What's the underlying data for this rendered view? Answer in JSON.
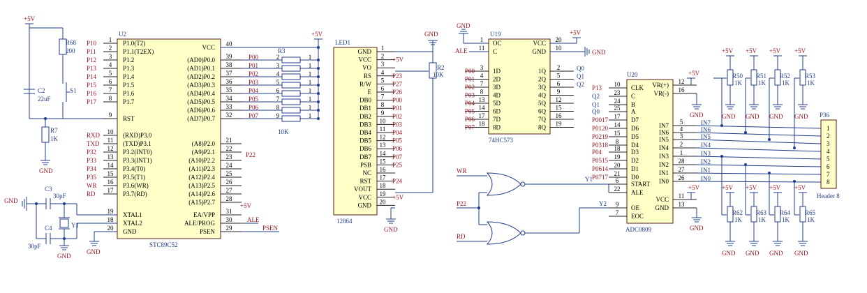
{
  "u2": {
    "ref": "U2",
    "name": "STC89C52",
    "left_pins": [
      {
        "num": "1",
        "name": "P1.0(T2)",
        "net": "P10"
      },
      {
        "num": "2",
        "name": "P1.1(T2EX)",
        "net": "P11"
      },
      {
        "num": "3",
        "name": "P1.2",
        "net": "P12"
      },
      {
        "num": "4",
        "name": "P1.3",
        "net": "P13"
      },
      {
        "num": "5",
        "name": "P1.4",
        "net": "P14"
      },
      {
        "num": "6",
        "name": "P1.5",
        "net": "P15"
      },
      {
        "num": "7",
        "name": "P1.6",
        "net": "P16"
      },
      {
        "num": "8",
        "name": "P1.7",
        "net": "P17"
      },
      {
        "num": "9",
        "name": "RST",
        "net": ""
      },
      {
        "num": "10",
        "name": "(RXD)P3.0",
        "net": "RXD"
      },
      {
        "num": "11",
        "name": "(TXD)P3.1",
        "net": "TXD"
      },
      {
        "num": "12",
        "name": "P3.2(INT0)",
        "net": "P32"
      },
      {
        "num": "13",
        "name": "P3.3(INT1)",
        "net": "P33"
      },
      {
        "num": "14",
        "name": "P3.4(T0)",
        "net": "P34"
      },
      {
        "num": "15",
        "name": "P3.5(T1)",
        "net": "P35"
      },
      {
        "num": "16",
        "name": "P3.6(WR)",
        "net": "WR"
      },
      {
        "num": "17",
        "name": "P3.7(RD)",
        "net": "RD"
      },
      {
        "num": "19",
        "name": "XTAL1",
        "net": ""
      },
      {
        "num": "18",
        "name": "XTAL2",
        "net": ""
      },
      {
        "num": "20",
        "name": "GND",
        "net": ""
      }
    ],
    "right_pins": [
      {
        "num": "40",
        "name": "VCC",
        "net": "+5V"
      },
      {
        "num": "39",
        "name": "(AD0)P0.0",
        "net": "P00"
      },
      {
        "num": "38",
        "name": "(AD1)P0.1",
        "net": "P01"
      },
      {
        "num": "37",
        "name": "(AD2)P0.2",
        "net": "P02"
      },
      {
        "num": "36",
        "name": "(AD3)P0.3",
        "net": "P03"
      },
      {
        "num": "35",
        "name": "(AD4)P0.4",
        "net": "P04"
      },
      {
        "num": "34",
        "name": "(AD5)P0.5",
        "net": "P05"
      },
      {
        "num": "33",
        "name": "(AD6)P0.6",
        "net": "P06"
      },
      {
        "num": "32",
        "name": "(AD7)P0.7",
        "net": "P07"
      },
      {
        "num": "21",
        "name": "(A8)P2.0",
        "net": ""
      },
      {
        "num": "22",
        "name": "(A9)P2.1",
        "net": "P22"
      },
      {
        "num": "23",
        "name": "(A10)P2.2",
        "net": ""
      },
      {
        "num": "24",
        "name": "(A11)P2.3",
        "net": ""
      },
      {
        "num": "25",
        "name": "(A12)P2.4",
        "net": ""
      },
      {
        "num": "26",
        "name": "(A13)P2.5",
        "net": ""
      },
      {
        "num": "27",
        "name": "(A14)P2.6",
        "net": ""
      },
      {
        "num": "28",
        "name": "(A15)P2.7",
        "net": ""
      },
      {
        "num": "31",
        "name": "EA/VPP",
        "net": "+5V"
      },
      {
        "num": "30",
        "name": "ALE/PROG",
        "net": "ALE"
      },
      {
        "num": "29",
        "name": "PSEN",
        "net": "PSEN"
      }
    ]
  },
  "r3": {
    "ref": "R3",
    "value": "10K",
    "pins": [
      "1",
      "2",
      "3",
      "4",
      "5",
      "6",
      "7",
      "8",
      "9"
    ]
  },
  "reset": {
    "vcc": "+5V",
    "r68_ref": "R68",
    "r68_val": "200",
    "c2_ref": "C2",
    "c2_val": "22uF",
    "s1_ref": "S1",
    "r7_ref": "R7",
    "r7_val": "1K",
    "gnd": "GND"
  },
  "xtal": {
    "c3_ref": "C3",
    "c3_val": "30pF",
    "c4_ref": "C4",
    "c4_val": "30pF",
    "y1_ref": "Y1",
    "gnd": "GND",
    "gnd2": "GND",
    "gnd3": "GND"
  },
  "led1": {
    "ref": "LED1",
    "name": "12864",
    "pins": [
      {
        "num": "1",
        "name": "GND",
        "net": ""
      },
      {
        "num": "2",
        "name": "VCC",
        "net": "+5V"
      },
      {
        "num": "3",
        "name": "VO",
        "net": ""
      },
      {
        "num": "4",
        "name": "RS",
        "net": "P23"
      },
      {
        "num": "5",
        "name": "R/W",
        "net": "P27"
      },
      {
        "num": "6",
        "name": "E",
        "net": "P26"
      },
      {
        "num": "7",
        "name": "DB0",
        "net": "P00"
      },
      {
        "num": "8",
        "name": "DB1",
        "net": "P01"
      },
      {
        "num": "9",
        "name": "DB2",
        "net": "P02"
      },
      {
        "num": "10",
        "name": "DB3",
        "net": "P03"
      },
      {
        "num": "11",
        "name": "DB4",
        "net": "P04"
      },
      {
        "num": "12",
        "name": "DB5",
        "net": "P05"
      },
      {
        "num": "13",
        "name": "DB6",
        "net": "P06"
      },
      {
        "num": "14",
        "name": "DB7",
        "net": "P07"
      },
      {
        "num": "15",
        "name": "PSB",
        "net": "P25"
      },
      {
        "num": "16",
        "name": "NC",
        "net": ""
      },
      {
        "num": "17",
        "name": "RST",
        "net": "P24"
      },
      {
        "num": "18",
        "name": "VOUT",
        "net": ""
      },
      {
        "num": "19",
        "name": "VCC",
        "net": "+5V"
      },
      {
        "num": "20",
        "name": "GND",
        "net": ""
      }
    ],
    "gnd_top": "GND",
    "gnd_bot": "GND",
    "r2_ref": "R2",
    "r2_val": "10K"
  },
  "u19": {
    "ref": "U19",
    "name": "74HC573",
    "gnd": "GND",
    "vcc": "+5V",
    "ale": "ALE",
    "gnd_right": "GND",
    "top_left": [
      {
        "num": "1",
        "name": "OC"
      },
      {
        "num": "11",
        "name": "C"
      }
    ],
    "top_right": [
      {
        "num": "20",
        "name": "VCC"
      },
      {
        "num": "10",
        "name": "GND"
      }
    ],
    "d_pins": [
      {
        "num": "3",
        "name": "1D",
        "net": "P00"
      },
      {
        "num": "4",
        "name": "2D",
        "net": "P01"
      },
      {
        "num": "7",
        "name": "3D",
        "net": "P02"
      },
      {
        "num": "8",
        "name": "4D",
        "net": "P03"
      },
      {
        "num": "13",
        "name": "5D",
        "net": "P04"
      },
      {
        "num": "14",
        "name": "6D",
        "net": "P05"
      },
      {
        "num": "17",
        "name": "7D",
        "net": "P06"
      },
      {
        "num": "18",
        "name": "8D",
        "net": "P07"
      }
    ],
    "q_pins": [
      {
        "num": "2",
        "name": "1Q",
        "net": "Q0"
      },
      {
        "num": "5",
        "name": "2Q",
        "net": "Q1"
      },
      {
        "num": "6",
        "name": "3Q",
        "net": "Q2"
      },
      {
        "num": "9",
        "name": "4Q",
        "net": ""
      },
      {
        "num": "12",
        "name": "5Q",
        "net": ""
      },
      {
        "num": "15",
        "name": "6Q",
        "net": ""
      },
      {
        "num": "16",
        "name": "7Q",
        "net": ""
      },
      {
        "num": "19",
        "name": "8Q",
        "net": ""
      }
    ]
  },
  "gates": {
    "wr": "WR",
    "p22": "P22",
    "rd": "RD",
    "y1": "Y1",
    "y2": "Y2"
  },
  "u20": {
    "ref": "U20",
    "name": "ADC0809",
    "left_pins": [
      {
        "num": "10",
        "name": "CLK",
        "net": "P13"
      },
      {
        "num": "23",
        "name": "C",
        "net": "Q2"
      },
      {
        "num": "24",
        "name": "B",
        "net": "Q1"
      },
      {
        "num": "25",
        "name": "A",
        "net": "Q0"
      },
      {
        "num": "17",
        "name": "D7",
        "net": "P0017"
      },
      {
        "num": "14",
        "name": "D6",
        "net": "P0120"
      },
      {
        "num": "15",
        "name": "D5",
        "net": "P0219"
      },
      {
        "num": "8",
        "name": "D4",
        "net": "P0318"
      },
      {
        "num": "18",
        "name": "D3",
        "net": "P04"
      },
      {
        "num": "19",
        "name": "D2",
        "net": "P0515"
      },
      {
        "num": "20",
        "name": "D1",
        "net": "P0614"
      },
      {
        "num": "21",
        "name": "D0",
        "net": "P0717"
      },
      {
        "num": "6",
        "name": "START",
        "net": ""
      },
      {
        "num": "22",
        "name": "ALE",
        "net": ""
      },
      {
        "num": "9",
        "name": "OE",
        "net": ""
      },
      {
        "num": "7",
        "name": "EOC",
        "net": ""
      }
    ],
    "right_pins": [
      {
        "num": "12",
        "name": "VR(+)"
      },
      {
        "num": "16",
        "name": "VR(-)"
      },
      {
        "num": "5",
        "name": "IN7"
      },
      {
        "num": "4",
        "name": "IN6"
      },
      {
        "num": "3",
        "name": "IN5"
      },
      {
        "num": "2",
        "name": "IN4"
      },
      {
        "num": "1",
        "name": "IN3"
      },
      {
        "num": "28",
        "name": "IN2"
      },
      {
        "num": "27",
        "name": "IN1"
      },
      {
        "num": "26",
        "name": "IN0"
      },
      {
        "num": "11",
        "name": "VCC"
      },
      {
        "num": "13",
        "name": "GND"
      }
    ],
    "vcc": "+5V",
    "gnd": "GND"
  },
  "pots_top": [
    {
      "ref": "R50",
      "val": "1K"
    },
    {
      "ref": "R51",
      "val": "1K"
    },
    {
      "ref": "R52",
      "val": "1K"
    },
    {
      "ref": "R53",
      "val": "1K"
    }
  ],
  "pots_bot": [
    {
      "ref": "R62",
      "val": "1K"
    },
    {
      "ref": "R63",
      "val": "1K"
    },
    {
      "ref": "R64",
      "val": "1K"
    },
    {
      "ref": "R65",
      "val": "1K"
    }
  ],
  "in_nets": [
    "IN7",
    "IN6",
    "IN5",
    "IN4",
    "IN3",
    "IN2",
    "IN1",
    "IN0"
  ],
  "p36": {
    "ref": "P36",
    "name": "Header 8",
    "pins": [
      "1",
      "2",
      "3",
      "4",
      "5",
      "6",
      "7",
      "8"
    ]
  },
  "common": {
    "vcc": "+5V",
    "gnd": "GND"
  }
}
